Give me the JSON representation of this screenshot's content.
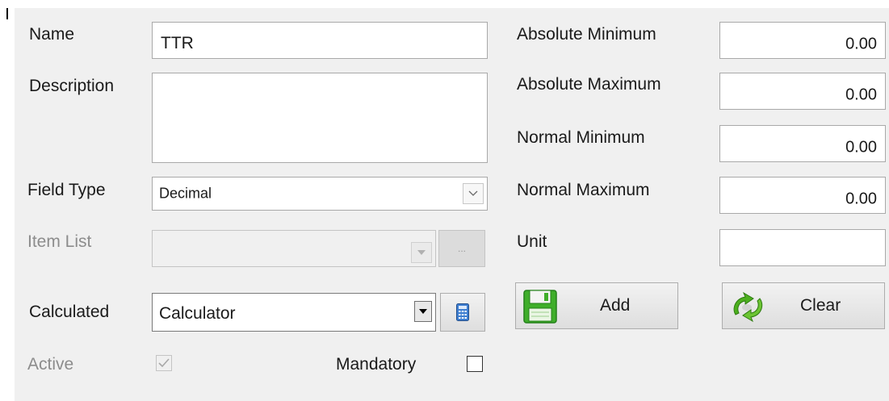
{
  "form": {
    "name": {
      "label": "Name",
      "value": "TTR"
    },
    "description": {
      "label": "Description",
      "value": ""
    },
    "field_type": {
      "label": "Field Type",
      "value": "Decimal"
    },
    "item_list": {
      "label": "Item List",
      "value": "",
      "browse_label": "..."
    },
    "calculated": {
      "label": "Calculated",
      "value": "Calculator"
    },
    "active": {
      "label": "Active",
      "checked": true,
      "enabled": false
    },
    "mandatory": {
      "label": "Mandatory",
      "checked": false
    },
    "absolute_minimum": {
      "label": "Absolute Minimum",
      "value": "0.00"
    },
    "absolute_maximum": {
      "label": "Absolute Maximum",
      "value": "0.00"
    },
    "normal_minimum": {
      "label": "Normal Minimum",
      "value": "0.00"
    },
    "normal_maximum": {
      "label": "Normal Maximum",
      "value": "0.00"
    },
    "unit": {
      "label": "Unit",
      "value": ""
    }
  },
  "buttons": {
    "add": {
      "label": "Add",
      "icon": "floppy-disk-icon"
    },
    "clear": {
      "label": "Clear",
      "icon": "recycle-icon"
    }
  },
  "colors": {
    "panel_bg": "#f0f0f0",
    "disabled_text": "#8c8c8c",
    "add_icon_green": "#3fae2a",
    "clear_icon_green": "#4caf1e"
  }
}
